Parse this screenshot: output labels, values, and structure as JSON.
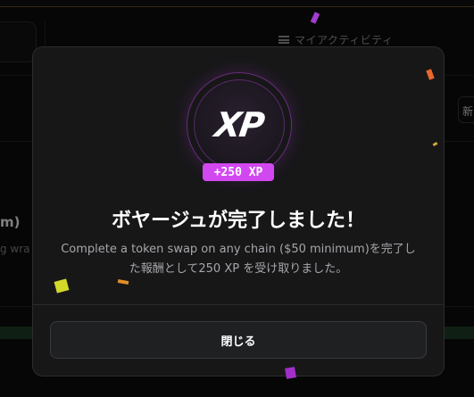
{
  "background": {
    "activity_label": "マイアクティビティ",
    "right_button_text": "新",
    "title_fragment": "m)",
    "subtitle_fragment": "g wra"
  },
  "modal": {
    "xp_logo": "XP",
    "xp_amount": "+250 XP",
    "title": "ボヤージュが完了しました！",
    "description": "Complete a token swap on any chain ($50 minimum)を完了した報酬として250 XP を受け取りました。",
    "close_label": "閉じる"
  },
  "colors": {
    "accent": "#d248f0",
    "modal_bg": "#171718",
    "page_bg": "#0b0b0c"
  }
}
